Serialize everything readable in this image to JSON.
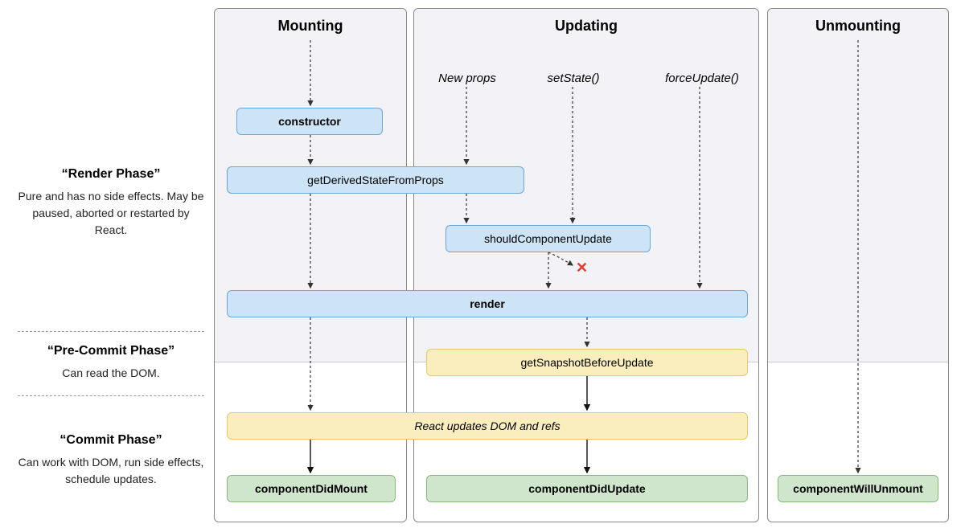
{
  "sidebar": {
    "render_phase_title": "“Render Phase”",
    "render_phase_desc": "Pure and has no side effects. May be paused, aborted or restarted by React.",
    "precommit_phase_title": "“Pre-Commit Phase”",
    "precommit_phase_desc": "Can read the DOM.",
    "commit_phase_title": "“Commit Phase”",
    "commit_phase_desc": "Can work with DOM, run side effects, schedule updates."
  },
  "columns": {
    "mounting_title": "Mounting",
    "updating_title": "Updating",
    "unmounting_title": "Unmounting"
  },
  "triggers": {
    "new_props": "New props",
    "set_state": "setState()",
    "force_update": "forceUpdate()"
  },
  "lifecycle": {
    "constructor": "constructor",
    "gdsfp": "getDerivedStateFromProps",
    "scu": "shouldComponentUpdate",
    "render": "render",
    "gsbu": "getSnapshotBeforeUpdate",
    "react_updates": "React updates DOM and refs",
    "cdm": "componentDidMount",
    "cdu": "componentDidUpdate",
    "cwu": "componentWillUnmount"
  }
}
